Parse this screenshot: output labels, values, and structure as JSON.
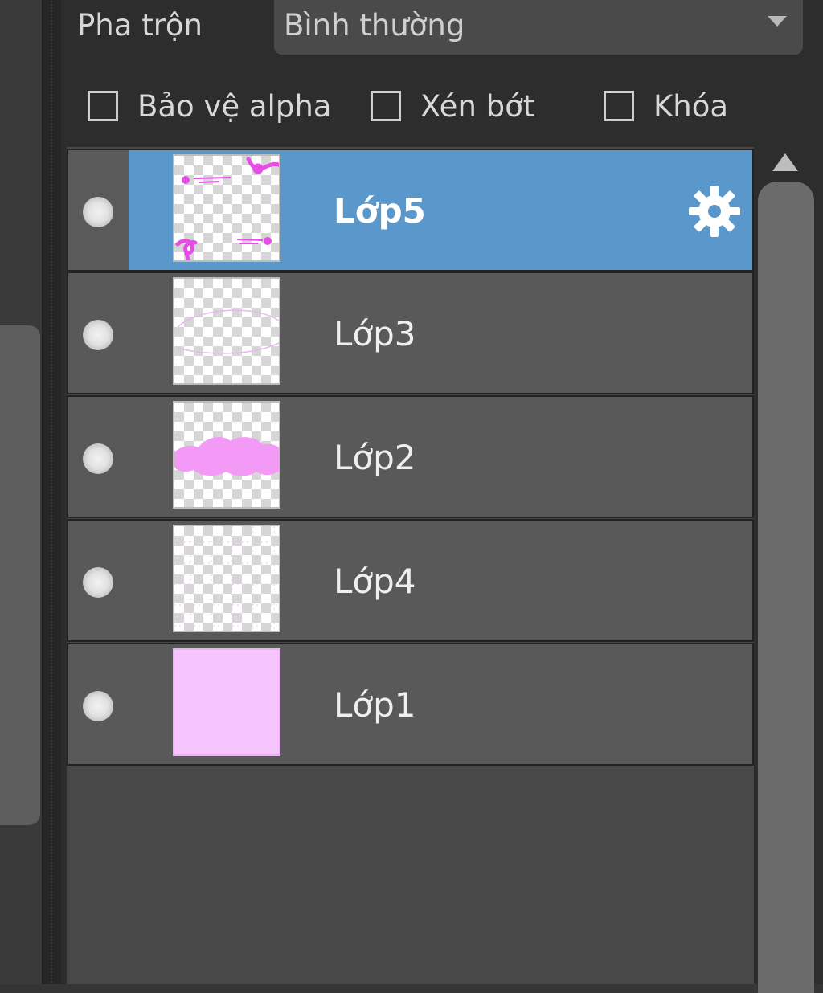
{
  "blend": {
    "label": "Pha trộn",
    "value": "Bình thường"
  },
  "options": {
    "protect_alpha": "Bảo vệ alpha",
    "clip": "Xén bớt",
    "lock": "Khóa"
  },
  "layers": [
    {
      "name": "Lớp5",
      "selected": true
    },
    {
      "name": "Lớp3",
      "selected": false
    },
    {
      "name": "Lớp2",
      "selected": false
    },
    {
      "name": "Lớp4",
      "selected": false
    },
    {
      "name": "Lớp1",
      "selected": false
    }
  ],
  "colors": {
    "selection": "#5a98cc",
    "paint": "#e64de6",
    "cloud": "#f29af5",
    "fill": "#f6c4ff"
  },
  "icons": {
    "settings": "gear-icon",
    "visibility": "visibility-dot-icon",
    "dropdown": "chevron-down-icon",
    "scroll_up": "scroll-up-arrow-icon"
  }
}
